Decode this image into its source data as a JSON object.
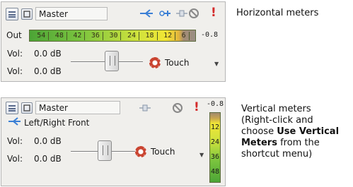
{
  "panel1": {
    "name": "Master",
    "out_label": "Out",
    "meter_ticks": [
      "54",
      "48",
      "42",
      "36",
      "30",
      "24",
      "18",
      "12",
      "6"
    ],
    "peak": "-0.8",
    "vol1_label": "Vol:",
    "vol1_value": "0.0 dB",
    "vol2_label": "Vol:",
    "vol2_value": "0.0 dB",
    "automation_label": "Touch"
  },
  "panel2": {
    "name": "Master",
    "peak": "-0.8",
    "output_label": "Left/Right Front",
    "vol1_label": "Vol:",
    "vol1_value": "0.0 dB",
    "vol2_label": "Vol:",
    "vol2_value": "0.0 dB",
    "automation_label": "Touch",
    "meter_ticks": [
      "12",
      "24",
      "36",
      "48"
    ]
  },
  "annotations": {
    "horizontal": "Horizontal meters",
    "vertical_1": "Vertical meters",
    "vertical_2": "(Right-click and",
    "vertical_3a": "choose ",
    "vertical_3b": "Use Vertical",
    "vertical_4a": "Meters",
    "vertical_4b": " from the",
    "vertical_5": "shortcut menu)"
  },
  "colors": {
    "meter_green": "#4ca436",
    "meter_yellow": "#f2e634",
    "record_red": "#c9432f",
    "warning_red": "#d42b2b"
  }
}
